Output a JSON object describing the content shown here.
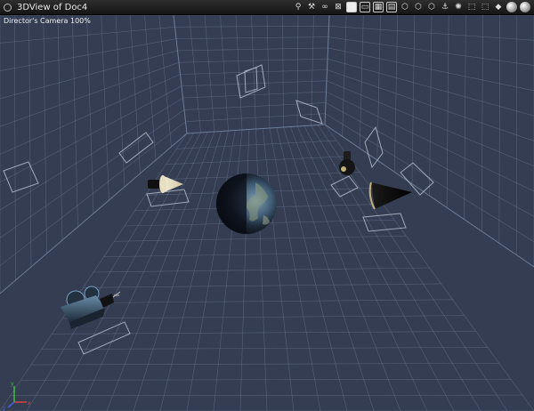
{
  "window": {
    "title": "3DView of Doc4",
    "camera_label": "Director's Camera 100%"
  },
  "toolbar": {
    "buttons": [
      {
        "name": "walk-icon",
        "glyph": "⚲"
      },
      {
        "name": "hand-icon",
        "glyph": "⚒"
      },
      {
        "name": "binoculars-icon",
        "glyph": "∞"
      },
      {
        "name": "fit-icon",
        "glyph": "⊠"
      },
      {
        "name": "single-view-icon",
        "glyph": ""
      },
      {
        "name": "two-views-icon",
        "glyph": "▭"
      },
      {
        "name": "four-views-icon",
        "glyph": "▦"
      },
      {
        "name": "grid-views-icon",
        "glyph": "▤"
      },
      {
        "name": "object-mode-icon",
        "glyph": "⬡"
      },
      {
        "name": "group-mode-icon",
        "glyph": "⬡"
      },
      {
        "name": "polygon-mode-icon",
        "glyph": "⬡"
      },
      {
        "name": "director-camera-icon",
        "glyph": "⚓"
      },
      {
        "name": "light-icon",
        "glyph": "✺"
      },
      {
        "name": "bounding-box-icon",
        "glyph": "⬚"
      },
      {
        "name": "wireframe-icon",
        "glyph": "⬚"
      },
      {
        "name": "flat-shade-icon",
        "glyph": "◆"
      },
      {
        "name": "smooth-shade-icon",
        "glyph": "●"
      },
      {
        "name": "texture-shade-icon",
        "glyph": "●"
      }
    ]
  },
  "colors": {
    "background": "#343d52",
    "grid": "#6f7f98",
    "accent_axis_x": "#e04040",
    "accent_axis_y": "#40c040",
    "accent_axis_z": "#4060e0"
  }
}
